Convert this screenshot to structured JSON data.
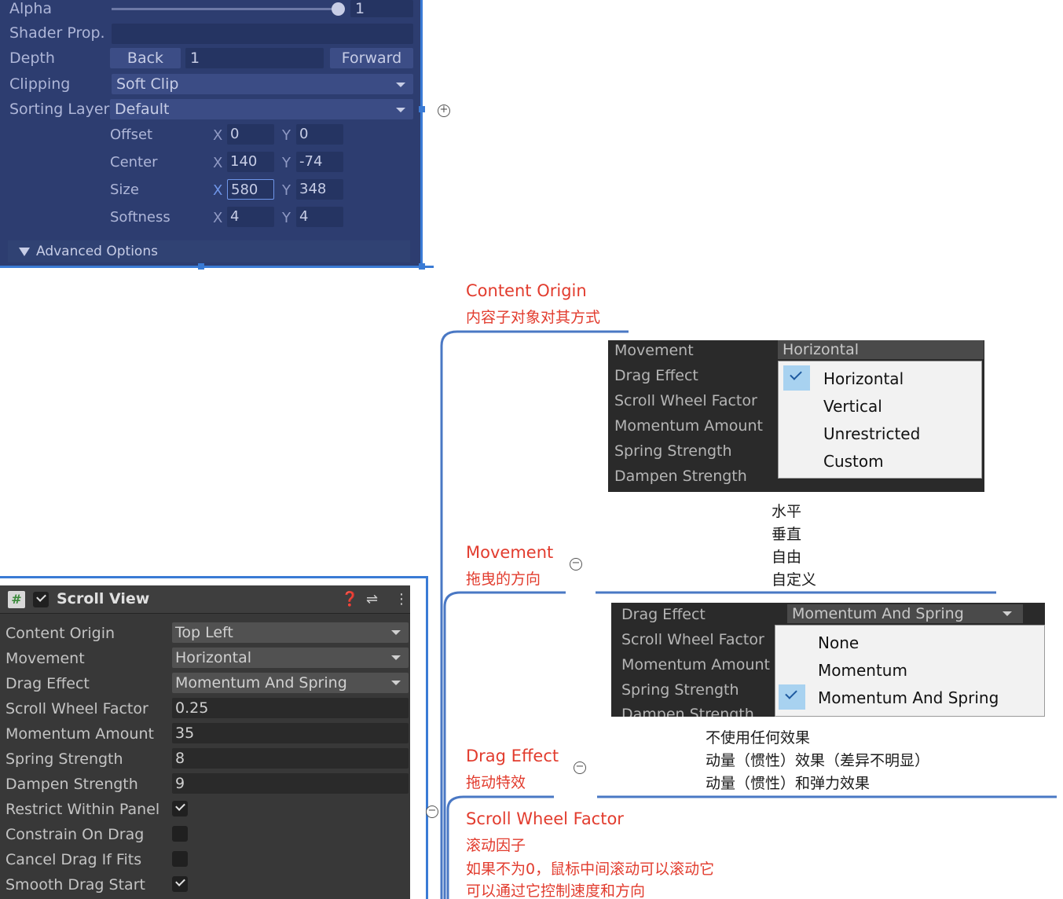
{
  "top_panel": {
    "alpha_label": "Alpha",
    "alpha_value": "1",
    "alpha_level": 1,
    "shader_label": "Shader Prop.",
    "depth_label": "Depth",
    "back_label": "Back",
    "depth_value": "1",
    "forward_label": "Forward",
    "clipping_label": "Clipping",
    "clipping_value": "Soft Clip",
    "sorting_label": "Sorting Layer",
    "sorting_value": "Default",
    "rows": [
      {
        "label": "Offset",
        "x": "0",
        "y": "0"
      },
      {
        "label": "Center",
        "x": "140",
        "y": "-74"
      },
      {
        "label": "Size",
        "x": "580",
        "y": "348"
      },
      {
        "label": "Softness",
        "x": "4",
        "y": "4"
      }
    ],
    "axis_x": "X",
    "axis_y": "Y",
    "advanced_label": "Advanced Options"
  },
  "mindmap": {
    "content_origin_title": "Content Origin",
    "content_origin_sub": "内容子对象对其方式",
    "movement_title": "Movement",
    "movement_sub": "拖曳的方向",
    "movement_notes": [
      "水平",
      "垂直",
      "自由",
      "自定义"
    ],
    "drag_title": "Drag Effect",
    "drag_sub": "拖动特效",
    "drag_notes": [
      "不使用任何效果",
      "动量（惯性）效果（差异不明显）",
      "动量（惯性）和弹力效果"
    ],
    "scroll_title": "Scroll Wheel Factor",
    "scroll_sub1": "滚动因子",
    "scroll_sub2": "如果不为0，鼠标中间滚动可以滚动它",
    "scroll_sub3": "可以通过它控制速度和方向"
  },
  "popup_movement": {
    "labels": [
      "Movement",
      "Drag Effect",
      "Scroll Wheel Factor",
      "Momentum Amount",
      "Spring Strength",
      "Dampen Strength"
    ],
    "header_value": "Horizontal",
    "options": [
      "Horizontal",
      "Vertical",
      "Unrestricted",
      "Custom"
    ],
    "selected_index": 0
  },
  "popup_drag": {
    "labels": [
      "Drag Effect",
      "Scroll Wheel Factor",
      "Momentum Amount",
      "Spring Strength",
      "Dampen Strength"
    ],
    "header_value": "Momentum And Spring",
    "options": [
      "None",
      "Momentum",
      "Momentum And Spring"
    ],
    "selected_index": 2
  },
  "scroll_view": {
    "title": "Scroll View",
    "dropdowns": [
      {
        "label": "Content Origin",
        "value": "Top Left"
      },
      {
        "label": "Movement",
        "value": "Horizontal"
      },
      {
        "label": "Drag Effect",
        "value": "Momentum And Spring"
      }
    ],
    "fields": [
      {
        "label": "Scroll Wheel Factor",
        "value": "0.25"
      },
      {
        "label": "Momentum Amount",
        "value": "35"
      },
      {
        "label": "Spring Strength",
        "value": "8"
      },
      {
        "label": "Dampen Strength",
        "value": "9"
      }
    ],
    "toggles": [
      {
        "label": "Restrict Within Panel",
        "checked": true
      },
      {
        "label": "Constrain On Drag",
        "checked": false
      },
      {
        "label": "Cancel Drag If Fits",
        "checked": false
      },
      {
        "label": "Smooth Drag Start",
        "checked": true
      }
    ]
  }
}
